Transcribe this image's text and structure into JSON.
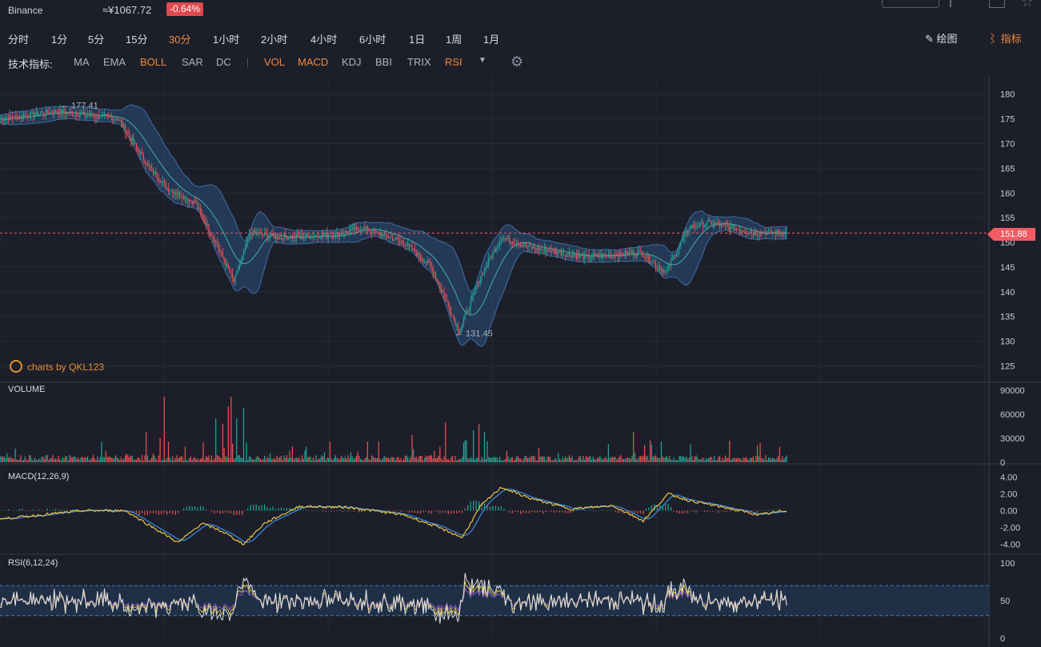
{
  "header": {
    "exchange": "Binance",
    "price": "≈¥1067.72",
    "change": "-0.64%"
  },
  "timeframes": [
    "分时",
    "1分",
    "5分",
    "15分",
    "30分",
    "1小时",
    "2小时",
    "4小时",
    "6小时",
    "1日",
    "1周",
    "1月"
  ],
  "active_timeframe": "30分",
  "toolbar": {
    "draw_label": "绘图",
    "indicator_label": "指标"
  },
  "indicator_bar": {
    "label": "技术指标:",
    "main_indicators": [
      "MA",
      "EMA",
      "BOLL",
      "SAR",
      "DC"
    ],
    "sub_indicators": [
      "VOL",
      "MACD",
      "KDJ",
      "BBI",
      "TRIX",
      "RSI"
    ],
    "active": [
      "BOLL",
      "VOL",
      "MACD",
      "RSI"
    ]
  },
  "watermark": "charts by QKL123",
  "colors": {
    "up": "#26a69a",
    "down": "#ef5350",
    "accent": "#f0883e",
    "boll_band": "#2b4f7a",
    "macd_dif": "#e8c547",
    "macd_dea": "#3a8ee6",
    "rsi6": "#e0e0e0",
    "rsi12": "#d8c040",
    "rsi24": "#8f5ad8"
  },
  "chart_data": [
    {
      "type": "candlestick",
      "overlay": "BOLL",
      "ylim": [
        122,
        184
      ],
      "yticks": [
        125,
        130,
        135,
        140,
        145,
        150,
        155,
        160,
        165,
        170,
        175,
        180
      ],
      "last_price": "151.88",
      "annotations": [
        {
          "label": "← 177.41",
          "value": 177.41
        },
        {
          "label": "← 131.45",
          "value": 131.45
        }
      ],
      "close_path": [
        {
          "i": 0,
          "v": 175
        },
        {
          "i": 40,
          "v": 176.5
        },
        {
          "i": 85,
          "v": 175
        },
        {
          "i": 105,
          "v": 166
        },
        {
          "i": 120,
          "v": 161
        },
        {
          "i": 140,
          "v": 158
        },
        {
          "i": 155,
          "v": 150
        },
        {
          "i": 168,
          "v": 142
        },
        {
          "i": 180,
          "v": 152
        },
        {
          "i": 200,
          "v": 151
        },
        {
          "i": 240,
          "v": 151.5
        },
        {
          "i": 260,
          "v": 153
        },
        {
          "i": 290,
          "v": 150
        },
        {
          "i": 310,
          "v": 145
        },
        {
          "i": 322,
          "v": 137
        },
        {
          "i": 330,
          "v": 132
        },
        {
          "i": 345,
          "v": 143
        },
        {
          "i": 360,
          "v": 151
        },
        {
          "i": 380,
          "v": 149
        },
        {
          "i": 420,
          "v": 147
        },
        {
          "i": 460,
          "v": 148
        },
        {
          "i": 478,
          "v": 144
        },
        {
          "i": 495,
          "v": 153
        },
        {
          "i": 510,
          "v": 154
        },
        {
          "i": 540,
          "v": 152
        },
        {
          "i": 565,
          "v": 152
        }
      ]
    },
    {
      "type": "bar",
      "name": "VOLUME",
      "yticks": [
        0,
        30000,
        60000,
        90000
      ],
      "ylim": [
        0,
        95000
      ],
      "spikes": [
        {
          "i": 105,
          "v": 38000
        },
        {
          "i": 115,
          "v": 30000
        },
        {
          "i": 118,
          "v": 82000
        },
        {
          "i": 155,
          "v": 55000
        },
        {
          "i": 160,
          "v": 48000
        },
        {
          "i": 164,
          "v": 70000
        },
        {
          "i": 166,
          "v": 82000
        },
        {
          "i": 170,
          "v": 55000
        },
        {
          "i": 175,
          "v": 68000
        },
        {
          "i": 237,
          "v": 26000
        },
        {
          "i": 296,
          "v": 34000
        },
        {
          "i": 320,
          "v": 50000
        },
        {
          "i": 340,
          "v": 40000
        },
        {
          "i": 344,
          "v": 48000
        },
        {
          "i": 348,
          "v": 38000
        },
        {
          "i": 455,
          "v": 38000
        },
        {
          "i": 475,
          "v": 26000
        }
      ]
    },
    {
      "type": "line",
      "name": "MACD(12,26,9)",
      "yticks": [
        "4.00",
        "2.00",
        "0.00",
        "-2.00",
        "-4.00"
      ],
      "ylim": [
        -5,
        5
      ],
      "dif_path": [
        {
          "i": 0,
          "v": -1
        },
        {
          "i": 60,
          "v": 0
        },
        {
          "i": 90,
          "v": 0
        },
        {
          "i": 110,
          "v": -2
        },
        {
          "i": 128,
          "v": -3.8
        },
        {
          "i": 145,
          "v": -1.5
        },
        {
          "i": 160,
          "v": -2.5
        },
        {
          "i": 175,
          "v": -4
        },
        {
          "i": 190,
          "v": -1.5
        },
        {
          "i": 215,
          "v": 0.5
        },
        {
          "i": 250,
          "v": 0.4
        },
        {
          "i": 290,
          "v": -0.5
        },
        {
          "i": 315,
          "v": -2
        },
        {
          "i": 332,
          "v": -3.2
        },
        {
          "i": 345,
          "v": 0.5
        },
        {
          "i": 360,
          "v": 2.8
        },
        {
          "i": 380,
          "v": 1.5
        },
        {
          "i": 410,
          "v": 0.2
        },
        {
          "i": 440,
          "v": 0.6
        },
        {
          "i": 462,
          "v": -1.2
        },
        {
          "i": 480,
          "v": 2
        },
        {
          "i": 495,
          "v": 1.2
        },
        {
          "i": 520,
          "v": 0.4
        },
        {
          "i": 545,
          "v": -0.5
        },
        {
          "i": 565,
          "v": 0
        }
      ]
    },
    {
      "type": "line",
      "name": "RSI(6,12,24)",
      "yticks": [
        100,
        50,
        0
      ],
      "ylim": [
        0,
        100
      ],
      "band": [
        30,
        70
      ]
    }
  ]
}
